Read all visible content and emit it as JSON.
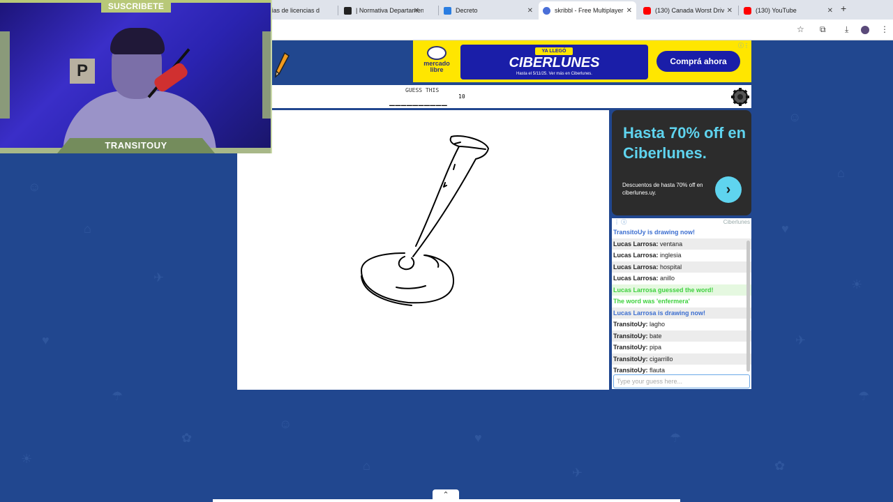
{
  "tabs": [
    {
      "label": "rías de licencias d",
      "color": "#ffffff"
    },
    {
      "label": "| Normativa Departament",
      "color": "#222222"
    },
    {
      "label": "Decreto",
      "color": "#2a7de1"
    },
    {
      "label": "skribbl - Free Multiplayer",
      "color": "#4a6fd8",
      "active": true
    },
    {
      "label": "(130) Canada Worst Drive",
      "color": "#ff0000"
    },
    {
      "label": "(130) YouTube",
      "color": "#ff0000"
    }
  ],
  "webcam": {
    "subscribe_label": "SUSCRIBETE",
    "channel_name": "TRANSITOUY",
    "sign_letter": "P"
  },
  "ad_top": {
    "brand_line1": "mercado",
    "brand_line2": "libre",
    "ribbon": "YA LLEGÓ",
    "title": "CIBERLUNES",
    "subtitle": "Hasta el 5/11/25. Ver más en Ciberlunes.",
    "cta": "Comprá ahora"
  },
  "game": {
    "guess_label": "GUESS THIS",
    "word_blanks": "__________",
    "word_length": "10"
  },
  "ad_side": {
    "title": "Hasta 70% off en Ciberlunes.",
    "description": "Descuentos de hasta 70% off en ciberlunes.uy.",
    "attribution": "Ciberlunes"
  },
  "chat": {
    "messages": [
      {
        "type": "system-blue",
        "text": "TransitoUy is drawing now!"
      },
      {
        "type": "guess",
        "author": "Lucas Larrosa:",
        "text": "ventana"
      },
      {
        "type": "guess",
        "author": "Lucas Larrosa:",
        "text": "inglesia"
      },
      {
        "type": "guess",
        "author": "Lucas Larrosa:",
        "text": "hospital"
      },
      {
        "type": "guess",
        "author": "Lucas Larrosa:",
        "text": "anillo"
      },
      {
        "type": "system-green",
        "text": "Lucas Larrosa guessed the word!"
      },
      {
        "type": "system-green",
        "text": "The word was 'enfermera'"
      },
      {
        "type": "system-blue",
        "text": "Lucas Larrosa is drawing now!"
      },
      {
        "type": "guess",
        "author": "TransitoUy:",
        "text": "lagho"
      },
      {
        "type": "guess",
        "author": "TransitoUy:",
        "text": "bate"
      },
      {
        "type": "guess",
        "author": "TransitoUy:",
        "text": "pipa"
      },
      {
        "type": "guess",
        "author": "TransitoUy:",
        "text": "cigarrillo"
      },
      {
        "type": "guess",
        "author": "TransitoUy:",
        "text": "flauta"
      }
    ],
    "input_placeholder": "Type your guess here..."
  }
}
